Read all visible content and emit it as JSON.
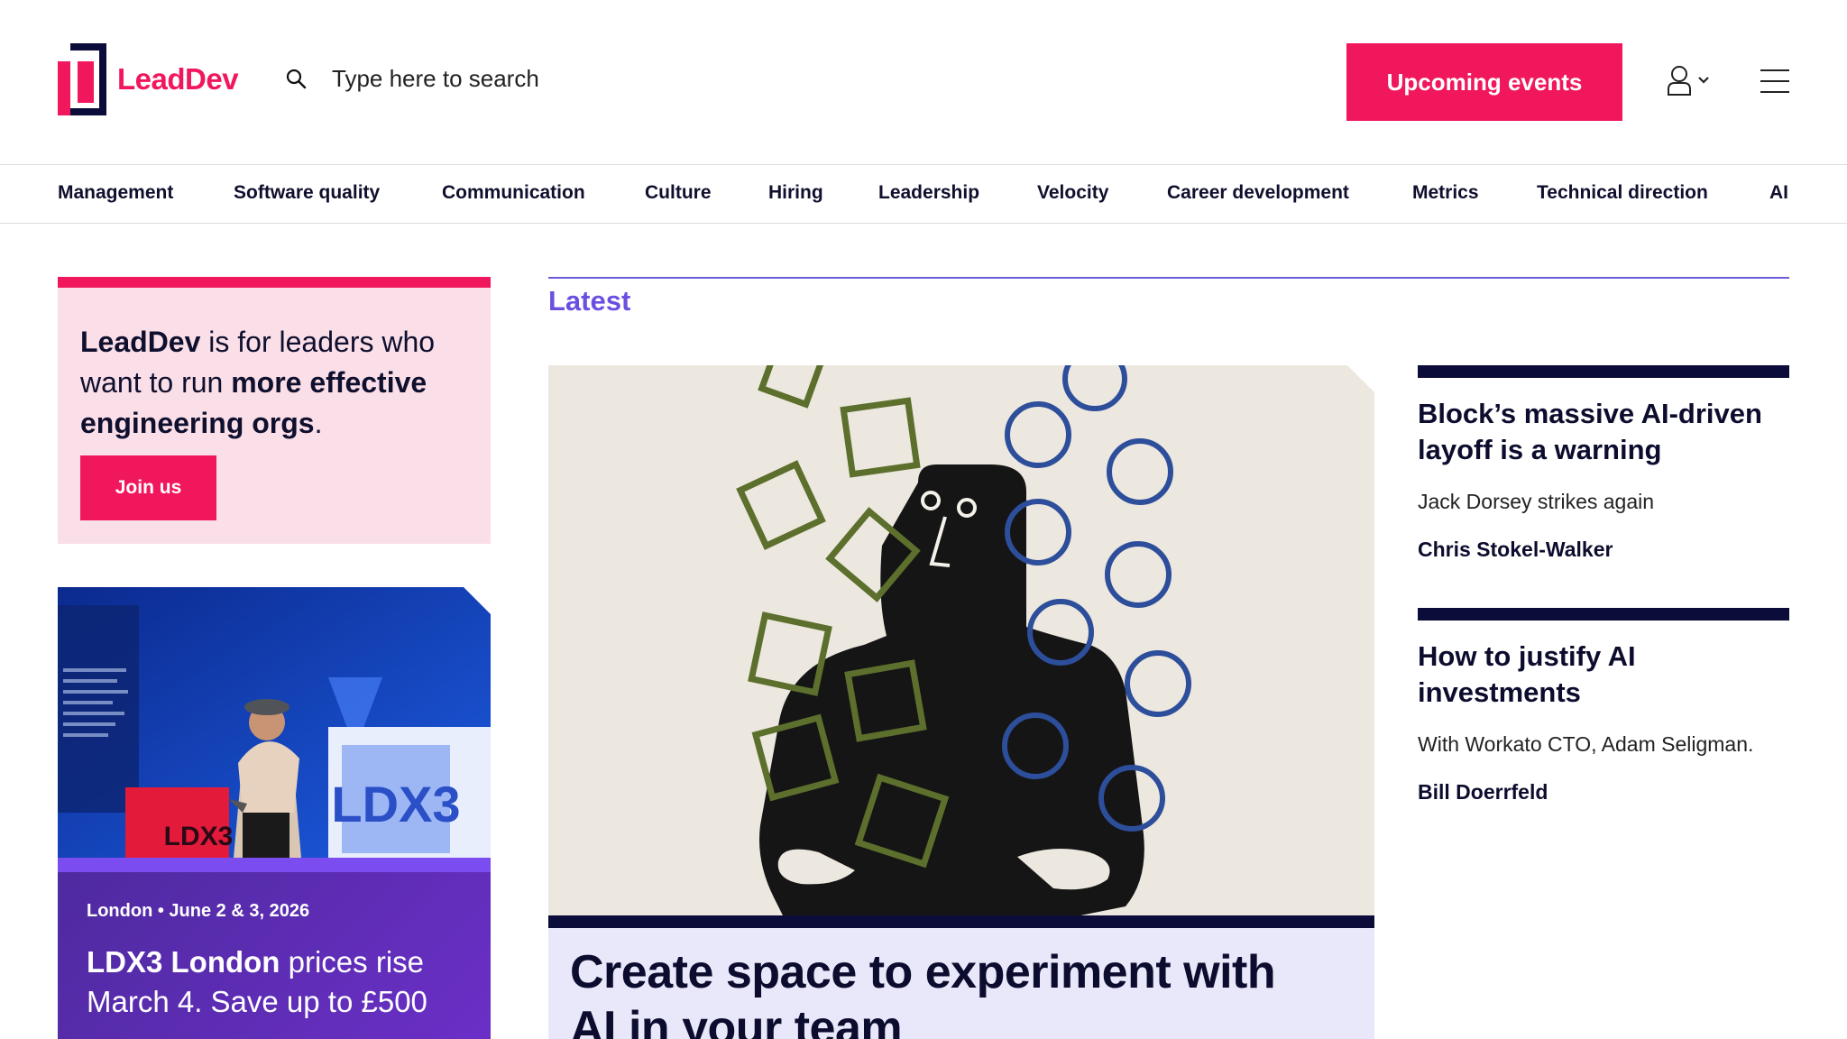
{
  "header": {
    "logo_text": "LeadDev",
    "search_placeholder": "Type here to search",
    "events_button": "Upcoming events"
  },
  "nav": {
    "items": [
      "Management",
      "Software quality",
      "Communication",
      "Culture",
      "Hiring",
      "Leadership",
      "Velocity",
      "Career development",
      "Metrics",
      "Technical direction",
      "AI"
    ]
  },
  "promo": {
    "brand": "LeadDev",
    "text_1": " is for leaders who want to run ",
    "emphasis": "more effective engineering orgs",
    "text_2": ".",
    "join_button": "Join us"
  },
  "event": {
    "meta": "London • June 2 & 3, 2026",
    "title_bold": "LDX3 London",
    "title_rest": " prices rise March 4. Save up to £500",
    "badge_1": "LDX3",
    "badge_2": "LDX3"
  },
  "latest": {
    "section_title": "Latest",
    "feature_title": "Create space to experiment with AI in your team"
  },
  "articles": [
    {
      "title": "Block’s massive AI-driven layoff is a warning",
      "description": "Jack Dorsey strikes again",
      "author": "Chris Stokel-Walker"
    },
    {
      "title": "How to justify AI investments",
      "description": "With Workato CTO, Adam Seligman.",
      "author": "Bill Doerrfeld"
    }
  ],
  "colors": {
    "brand_pink": "#f0175c",
    "navy": "#0c0c3a",
    "purple": "#6a4fe0"
  }
}
